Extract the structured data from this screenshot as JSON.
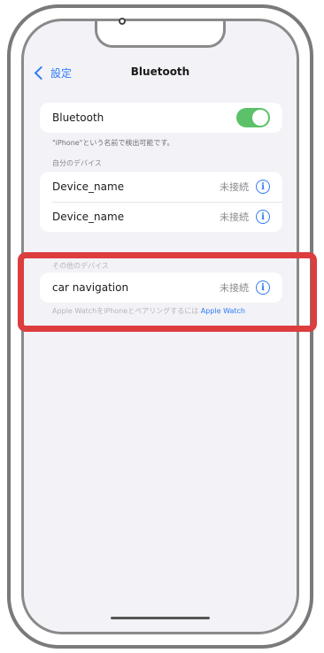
{
  "nav": {
    "back_label": "設定",
    "title": "Bluetooth"
  },
  "bluetooth_row": {
    "label": "Bluetooth",
    "toggle_on": true
  },
  "discoverable_caption": "\"iPhone\"という名前で検出可能です。",
  "my_devices": {
    "header": "自分のデバイス",
    "items": [
      {
        "name": "Device_name",
        "status": "未接続"
      },
      {
        "name": "Device_name",
        "status": "未接続"
      }
    ]
  },
  "other_devices": {
    "header": "その他のデバイス",
    "items": [
      {
        "name": "car navigation",
        "status": "未接続"
      }
    ]
  },
  "footer": {
    "text": "Apple WatchをiPhoneとペアリングするには",
    "link": "Apple Watch"
  },
  "icons": {
    "info": "info-icon",
    "back": "chevron-left-icon"
  },
  "colors": {
    "accent": "#2f7cf6",
    "toggle_on": "#5cc168",
    "highlight": "#dc3d3d"
  }
}
